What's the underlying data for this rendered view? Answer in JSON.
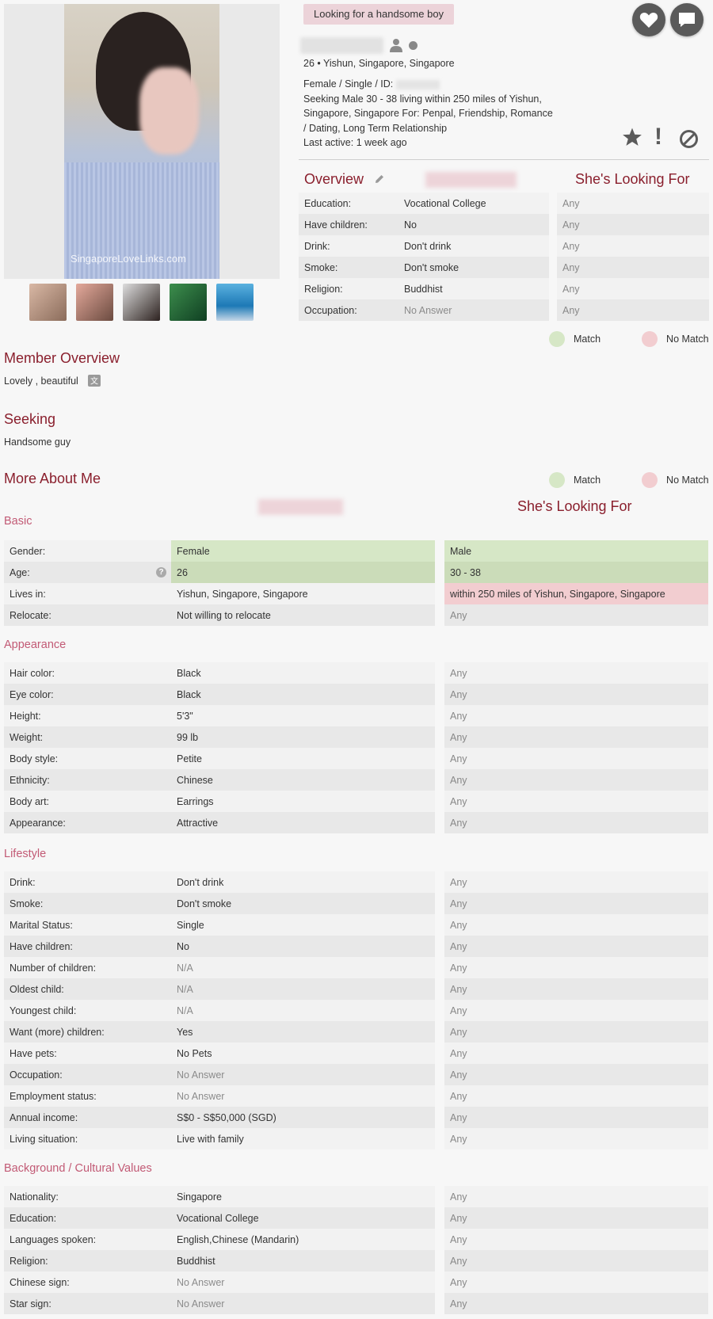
{
  "profile": {
    "tagline": "Looking for a handsome boy",
    "location_line": "26 • Yishun, Singapore, Singapore",
    "id_line": "Female / Single / ID:",
    "seeking_line": "Seeking Male 30 - 38 living within 250 miles of Yishun, Singapore, Singapore For: Penpal, Friendship, Romance / Dating, Long Term Relationship",
    "last_active": "Last active: 1 week ago",
    "photo_watermark": "SingaporeLoveLinks.com"
  },
  "icons": {
    "heart": "heart-icon",
    "chat": "chat-icon",
    "star": "star-icon",
    "report": "exclamation-icon",
    "block": "block-icon",
    "user": "user-icon",
    "edit": "pencil-icon",
    "translate": "translate-icon",
    "help": "question-icon"
  },
  "colors": {
    "accent": "#8a1f2d",
    "subheading": "#c25a75",
    "match": "#d6e7c6",
    "no_match": "#f2cdd0"
  },
  "overview": {
    "title": "Overview",
    "looking_title": "She's Looking For",
    "rows": [
      {
        "label": "Education:",
        "value": "Vocational College",
        "want": "Any"
      },
      {
        "label": "Have children:",
        "value": "No",
        "want": "Any"
      },
      {
        "label": "Drink:",
        "value": "Don't drink",
        "want": "Any"
      },
      {
        "label": "Smoke:",
        "value": "Don't smoke",
        "want": "Any"
      },
      {
        "label": "Religion:",
        "value": "Buddhist",
        "want": "Any"
      },
      {
        "label": "Occupation:",
        "value": "No Answer",
        "want": "Any"
      }
    ]
  },
  "legend": {
    "match": "Match",
    "no_match": "No Match"
  },
  "member_overview": {
    "title": "Member Overview",
    "text": "Lovely , beautiful"
  },
  "seeking": {
    "title": "Seeking",
    "text": "Handsome guy"
  },
  "more_about": {
    "title": "More About Me",
    "looking_title": "She's Looking For"
  },
  "basic": {
    "title": "Basic",
    "rows": [
      {
        "label": "Gender:",
        "value": "Female",
        "want": "Male"
      },
      {
        "label": "Age:",
        "value": "26",
        "want": "30 - 38"
      },
      {
        "label": "Lives in:",
        "value": "Yishun, Singapore, Singapore",
        "want": "within 250 miles of Yishun, Singapore, Singapore"
      },
      {
        "label": "Relocate:",
        "value": "Not willing to relocate",
        "want": "Any"
      }
    ]
  },
  "appearance": {
    "title": "Appearance",
    "rows": [
      {
        "label": "Hair color:",
        "value": "Black",
        "want": "Any"
      },
      {
        "label": "Eye color:",
        "value": "Black",
        "want": "Any"
      },
      {
        "label": "Height:",
        "value": "5'3\"",
        "want": "Any"
      },
      {
        "label": "Weight:",
        "value": "99 lb",
        "want": "Any"
      },
      {
        "label": "Body style:",
        "value": "Petite",
        "want": "Any"
      },
      {
        "label": "Ethnicity:",
        "value": "Chinese",
        "want": "Any"
      },
      {
        "label": "Body art:",
        "value": "Earrings",
        "want": "Any"
      },
      {
        "label": "Appearance:",
        "value": "Attractive",
        "want": "Any"
      }
    ]
  },
  "lifestyle": {
    "title": "Lifestyle",
    "rows": [
      {
        "label": "Drink:",
        "value": "Don't drink",
        "want": "Any"
      },
      {
        "label": "Smoke:",
        "value": "Don't smoke",
        "want": "Any"
      },
      {
        "label": "Marital Status:",
        "value": "Single",
        "want": "Any"
      },
      {
        "label": "Have children:",
        "value": "No",
        "want": "Any"
      },
      {
        "label": "Number of children:",
        "value": "N/A",
        "want": "Any"
      },
      {
        "label": "Oldest child:",
        "value": "N/A",
        "want": "Any"
      },
      {
        "label": "Youngest child:",
        "value": "N/A",
        "want": "Any"
      },
      {
        "label": "Want (more) children:",
        "value": "Yes",
        "want": "Any"
      },
      {
        "label": "Have pets:",
        "value": "No Pets",
        "want": "Any"
      },
      {
        "label": "Occupation:",
        "value": "No Answer",
        "want": "Any"
      },
      {
        "label": "Employment status:",
        "value": "No Answer",
        "want": "Any"
      },
      {
        "label": "Annual income:",
        "value": "S$0 - S$50,000 (SGD)",
        "want": "Any"
      },
      {
        "label": "Living situation:",
        "value": "Live with family",
        "want": "Any"
      }
    ]
  },
  "background": {
    "title": "Background / Cultural Values",
    "rows": [
      {
        "label": "Nationality:",
        "value": "Singapore",
        "want": "Any"
      },
      {
        "label": "Education:",
        "value": "Vocational College",
        "want": "Any"
      },
      {
        "label": "Languages spoken:",
        "value": "English,Chinese (Mandarin)",
        "want": "Any"
      },
      {
        "label": "Religion:",
        "value": "Buddhist",
        "want": "Any"
      },
      {
        "label": "Chinese sign:",
        "value": "No Answer",
        "want": "Any"
      },
      {
        "label": "Star sign:",
        "value": "No Answer",
        "want": "Any"
      }
    ]
  }
}
